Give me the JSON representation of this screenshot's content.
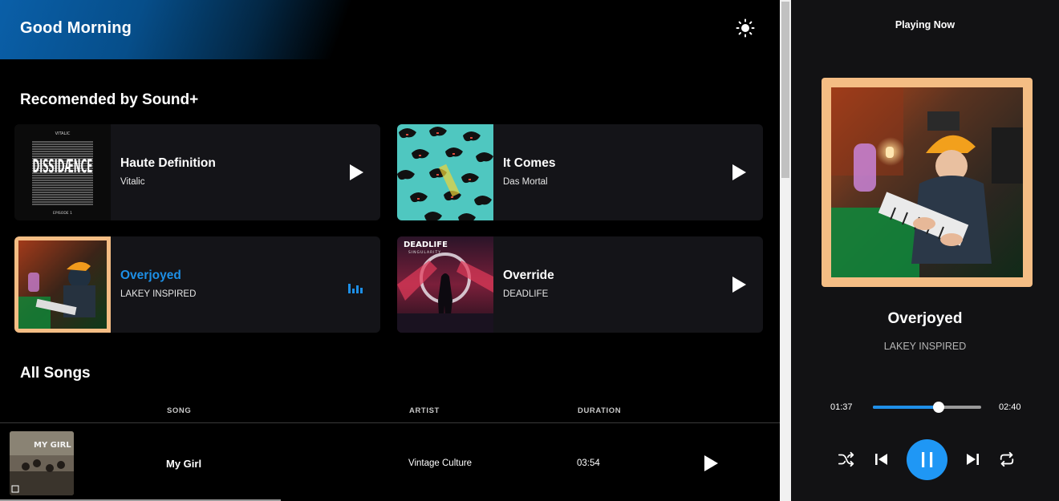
{
  "header": {
    "greeting": "Good Morning",
    "theme_icon": "sun-icon"
  },
  "recommended": {
    "title": "Recomended by Sound+",
    "cards": [
      {
        "title": "Haute Definition",
        "artist": "Vitalic",
        "state": "idle",
        "cover_text_top": "VITALIC",
        "cover_text_main": "DISSIDÆNCE",
        "cover_text_bottom": "EPISODE 1"
      },
      {
        "title": "It Comes",
        "artist": "Das Mortal",
        "state": "idle"
      },
      {
        "title": "Overjoyed",
        "artist": "LAKEY INSPIRED",
        "state": "playing"
      },
      {
        "title": "Override",
        "artist": "DEADLIFE",
        "state": "idle",
        "cover_text_top": "DEADLIFE",
        "cover_text_sub": "SINGULARITY"
      }
    ]
  },
  "all_songs": {
    "title": "All Songs",
    "columns": [
      "SONG",
      "ARTIST",
      "DURATION"
    ],
    "rows": [
      {
        "song": "My Girl",
        "artist": "Vintage Culture",
        "duration": "03:54",
        "cover_text": "MY GIRL"
      }
    ]
  },
  "player": {
    "heading": "Playing Now",
    "title": "Overjoyed",
    "artist": "LAKEY INSPIRED",
    "elapsed": "01:37",
    "total": "02:40",
    "progress": 0.606,
    "colors": {
      "accent": "#1f97f5",
      "cover_border": "#f4bd84"
    }
  }
}
